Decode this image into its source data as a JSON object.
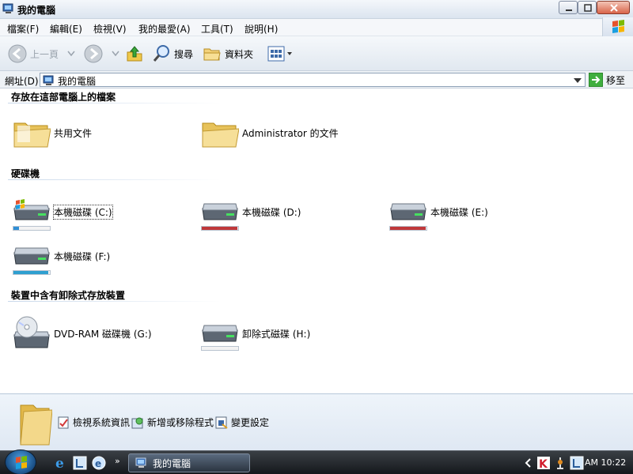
{
  "window": {
    "title": "我的電腦"
  },
  "menu": [
    "檔案(F)",
    "編輯(E)",
    "檢視(V)",
    "我的最愛(A)",
    "工具(T)",
    "說明(H)"
  ],
  "toolbar": {
    "back": "上一頁",
    "search": "搜尋",
    "folders": "資料夾"
  },
  "address": {
    "label": "網址(D)",
    "value": "我的電腦",
    "go": "移至"
  },
  "groups": {
    "files": "存放在這部電腦上的檔案",
    "drives": "硬碟機",
    "removable": "裝置中含有卸除式存放裝置"
  },
  "files": [
    {
      "label": "共用文件"
    },
    {
      "label": "Administrator 的文件"
    }
  ],
  "drives": [
    {
      "label": "本機磁碟 (C:)",
      "used": 0.15,
      "color": "#2f8fd6"
    },
    {
      "label": "本機磁碟 (D:)",
      "used": 0.98,
      "color": "#c0383a"
    },
    {
      "label": "本機磁碟 (E:)",
      "used": 0.98,
      "color": "#c0383a"
    },
    {
      "label": "本機磁碟 (F:)",
      "used": 0.95,
      "color": "#2f9fd0"
    }
  ],
  "removable": [
    {
      "label": "DVD-RAM 磁碟機 (G:)"
    },
    {
      "label": "卸除式磁碟 (H:)",
      "used": 0.0
    }
  ],
  "tasks": [
    "檢視系統資訊",
    "新增或移除程式",
    "變更設定"
  ],
  "taskbar": {
    "active": "我的電腦",
    "clock": "AM 10:22"
  }
}
